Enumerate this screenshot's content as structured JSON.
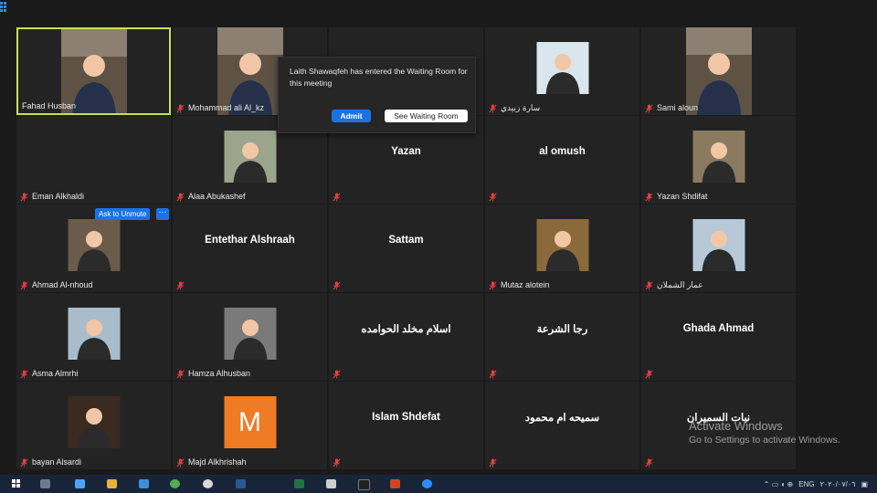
{
  "participants": [
    {
      "name": "Fahad Husban",
      "kind": "video",
      "active": true,
      "muted": false
    },
    {
      "name": "Mohammad ali Al_kz",
      "kind": "video",
      "muted": true
    },
    {
      "name": "",
      "kind": "covered",
      "muted": false
    },
    {
      "name": "سارة زبيدي",
      "kind": "photo",
      "muted": true,
      "bg": "#d9e6ee"
    },
    {
      "name": "Sami aloun",
      "kind": "video",
      "muted": true
    },
    {
      "name": "Eman Alkhaldi",
      "kind": "blank",
      "muted": true
    },
    {
      "name": "Alaa Abukashef",
      "kind": "photo",
      "muted": true,
      "bg": "#9aa58c"
    },
    {
      "name": "Yazan",
      "kind": "name",
      "muted": true
    },
    {
      "name": "al omush",
      "kind": "name",
      "muted": true
    },
    {
      "name": "Yazan Shdifat",
      "kind": "photo",
      "muted": true,
      "bg": "#8a7a60"
    },
    {
      "name": "Ahmad Al-nhoud",
      "kind": "photo",
      "muted": true,
      "bg": "#6b5b4a"
    },
    {
      "name": "Entethar Alshraah",
      "kind": "name",
      "muted": true
    },
    {
      "name": "Sattam",
      "kind": "name",
      "muted": true
    },
    {
      "name": "Mutaz alotein",
      "kind": "photo",
      "muted": true,
      "bg": "#8a6a3a"
    },
    {
      "name": "عمار الشملان",
      "kind": "photo",
      "muted": true,
      "bg": "#b7c8d8"
    },
    {
      "name": "Asma Almrhi",
      "kind": "photo",
      "muted": true,
      "bg": "#a8bccc"
    },
    {
      "name": "Hamza Alhusban",
      "kind": "photo",
      "muted": true,
      "bg": "#7a7a7a"
    },
    {
      "name": "اسلام مخلد الحوامده",
      "kind": "name",
      "muted": true
    },
    {
      "name": "رجا الشرعة",
      "kind": "name",
      "muted": true
    },
    {
      "name": "Ghada Ahmad",
      "kind": "name",
      "muted": true
    },
    {
      "name": "bayan Alsardi",
      "kind": "photo",
      "muted": true,
      "bg": "#3a2a1f"
    },
    {
      "name": "Majd Alkhrishah",
      "kind": "avatar",
      "letter": "M",
      "muted": true
    },
    {
      "name": "Islam Shdefat",
      "kind": "name",
      "muted": true
    },
    {
      "name": "سميحه ام محمود",
      "kind": "name",
      "muted": true
    },
    {
      "name": "نبات السميران",
      "kind": "name",
      "muted": true
    }
  ],
  "hover_controls": {
    "ask_to_unmute": "Ask to Unmute",
    "more": "···"
  },
  "notification": {
    "message": "Laith Shawaqfeh has entered the Waiting Room for this meeting",
    "admit": "Admit",
    "see_waiting_room": "See Waiting Room"
  },
  "watermark": {
    "line1": "Activate Windows",
    "line2": "Go to Settings to activate Windows."
  },
  "taskbar": {
    "clock": "٢٠٢٠/٠٧/٠٦",
    "lang": "ENG"
  },
  "colors": {
    "active_speaker": "#c6e05b",
    "accent": "#1a73e8",
    "muted_icon": "#e04040",
    "tile": "#232323",
    "background": "#1a1a1a"
  }
}
